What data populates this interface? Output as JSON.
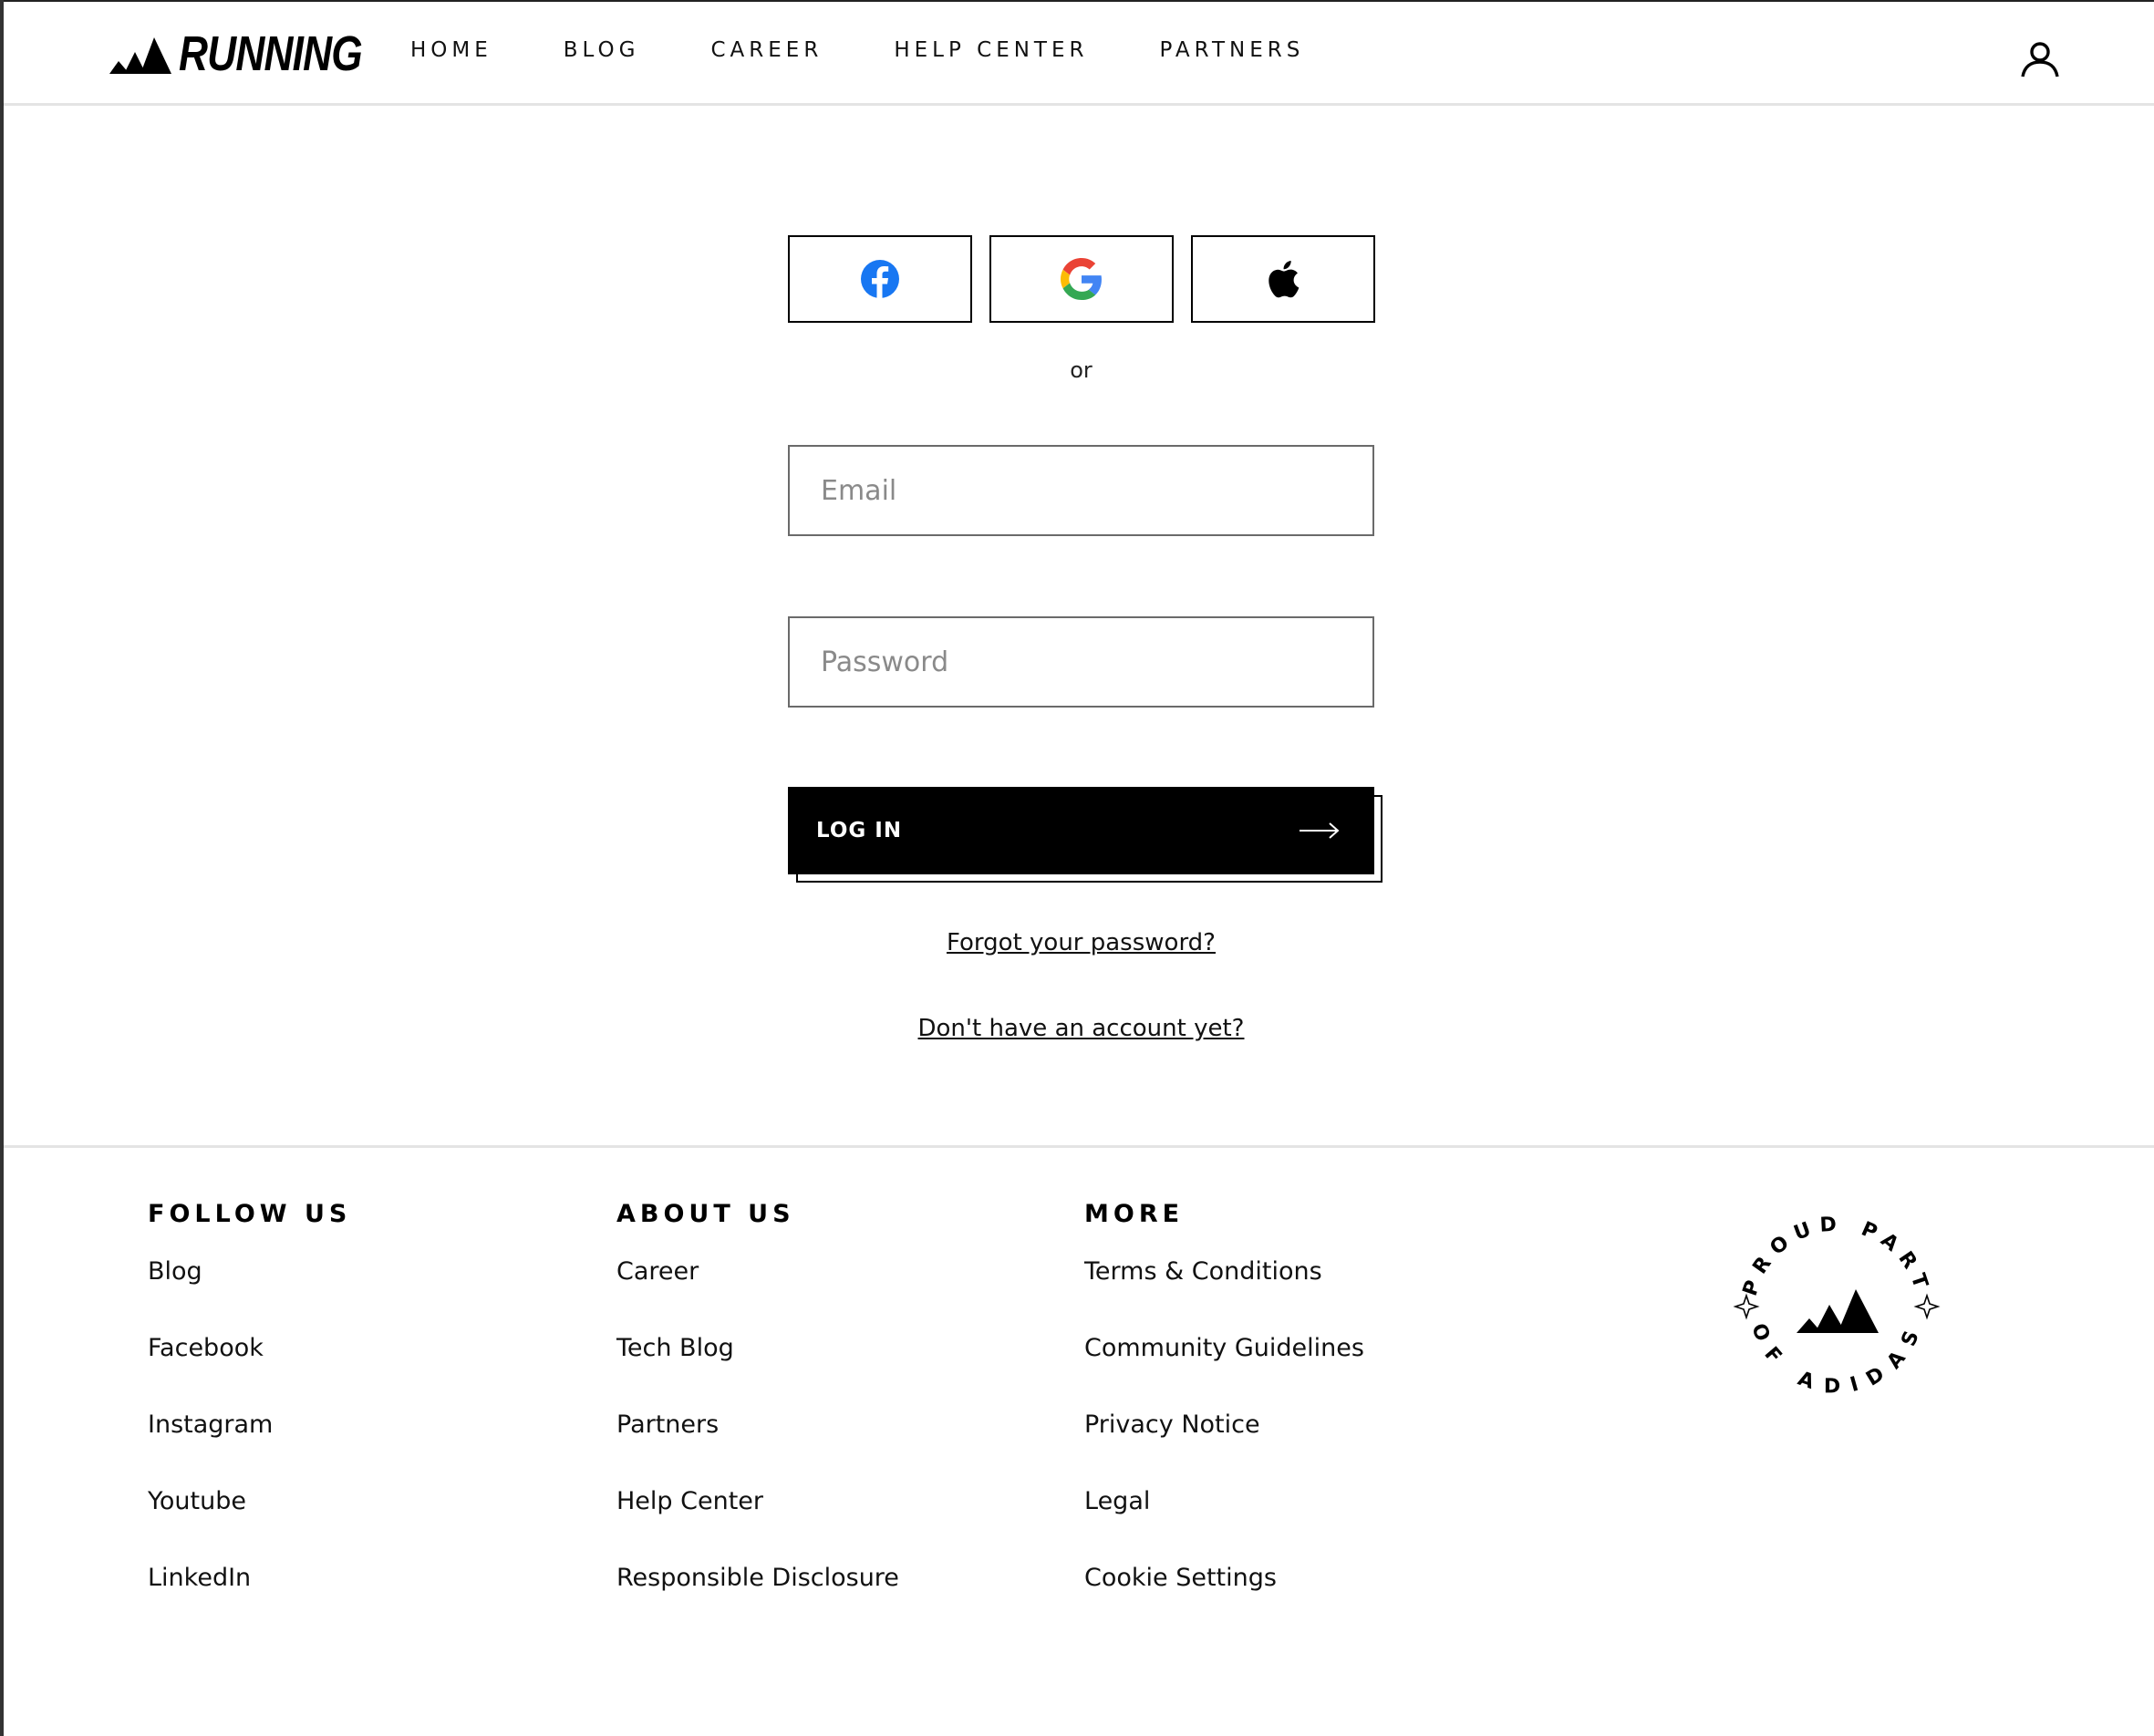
{
  "header": {
    "logo_text": "RUNNING",
    "nav": [
      "HOME",
      "BLOG",
      "CAREER",
      "HELP CENTER",
      "PARTNERS"
    ]
  },
  "login": {
    "social": [
      {
        "icon": "facebook-icon",
        "color": "#1877f2"
      },
      {
        "icon": "google-icon",
        "color": "#4285f4"
      },
      {
        "icon": "apple-icon",
        "color": "#000000"
      }
    ],
    "or_text": "or",
    "email_placeholder": "Email",
    "password_placeholder": "Password",
    "login_label": "LOG IN",
    "forgot_link": "Forgot your password?",
    "signup_link": "Don't have an account yet?"
  },
  "footer": {
    "follow_title": "FOLLOW US",
    "follow_links": [
      "Blog",
      "Facebook",
      "Instagram",
      "Youtube",
      "LinkedIn"
    ],
    "about_title": "ABOUT US",
    "about_links": [
      "Career",
      "Tech Blog",
      "Partners",
      "Help Center",
      "Responsible Disclosure"
    ],
    "more_title": "MORE",
    "more_links": [
      "Terms & Conditions",
      "Community Guidelines",
      "Privacy Notice",
      "Legal",
      "Cookie Settings"
    ],
    "badge_text": "PROUD PART OF ADIDAS"
  }
}
